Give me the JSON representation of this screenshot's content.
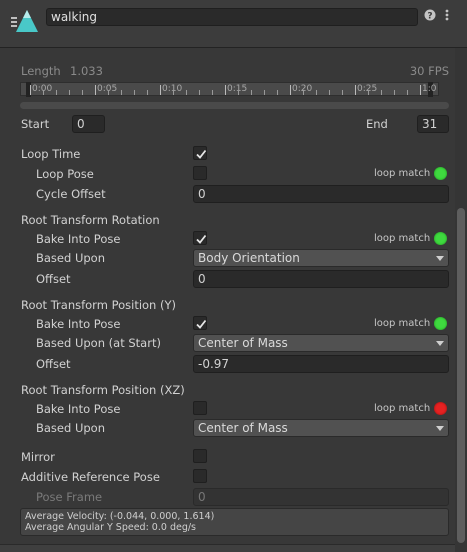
{
  "header": {
    "clip_name": "walking",
    "help_icon": "help-icon",
    "menu_icon": "kebab-menu-icon"
  },
  "timeline": {
    "length_label": "Length",
    "length_value": "1.033",
    "fps": "30 FPS",
    "ruler_labels": [
      "0:00",
      "0:05",
      "0:10",
      "0:15",
      "0:20",
      "0:25",
      "1:0"
    ]
  },
  "range": {
    "start_label": "Start",
    "start_value": "0",
    "end_label": "End",
    "end_value": "31"
  },
  "loop": {
    "loop_time_label": "Loop Time",
    "loop_time_checked": true,
    "loop_pose_label": "Loop Pose",
    "loop_pose_checked": false,
    "loop_pose_match": "loop match",
    "cycle_offset_label": "Cycle Offset",
    "cycle_offset_value": "0"
  },
  "root_rotation": {
    "title": "Root Transform Rotation",
    "bake_label": "Bake Into Pose",
    "bake_checked": true,
    "match": "loop match",
    "based_label": "Based Upon",
    "based_value": "Body Orientation",
    "offset_label": "Offset",
    "offset_value": "0"
  },
  "root_position_y": {
    "title": "Root Transform Position (Y)",
    "bake_label": "Bake Into Pose",
    "bake_checked": true,
    "match": "loop match",
    "based_label": "Based Upon (at Start)",
    "based_value": "Center of Mass",
    "offset_label": "Offset",
    "offset_value": "-0.97"
  },
  "root_position_xz": {
    "title": "Root Transform Position (XZ)",
    "bake_label": "Bake Into Pose",
    "bake_checked": false,
    "match": "loop match",
    "based_label": "Based Upon",
    "based_value": "Center of Mass"
  },
  "misc": {
    "mirror_label": "Mirror",
    "additive_label": "Additive Reference Pose",
    "pose_frame_label": "Pose Frame",
    "pose_frame_value": "0"
  },
  "summary": {
    "line1": "Average Velocity: (-0.044, 0.000, 1.614)",
    "line2": "Average Angular Y Speed: 0.0 deg/s"
  },
  "colors": {
    "match_green": "#3fd93f",
    "match_red": "#e62222",
    "panel_bg": "#383838"
  }
}
